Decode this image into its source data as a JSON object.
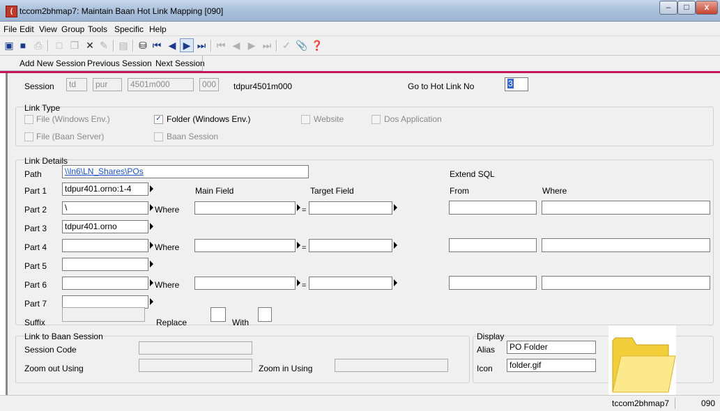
{
  "window": {
    "title": "tccom2bhmap7: Maintain Baan Hot Link Mapping [090]",
    "app_icon": "baan-app-icon",
    "minimize": "–",
    "maximize": "□",
    "close": "x"
  },
  "menu": [
    "File",
    "Edit",
    "View",
    "Group",
    "Tools",
    "Specific",
    "Help"
  ],
  "toolbar": {
    "buttons": [
      "save-and-close-icon",
      "save-icon",
      "print-icon",
      "new-icon",
      "duplicate-icon",
      "delete-icon",
      "change-icon",
      "text-icon",
      "find-icon",
      "first-record-icon",
      "previous-record-icon",
      "next-record-icon",
      "last-record-icon",
      "first-set-icon",
      "previous-set-icon",
      "next-set-icon",
      "last-set-icon",
      "special-icon",
      "attachment-icon",
      "whats-this-icon"
    ]
  },
  "session_bar": {
    "add_new_session": "Add New Session",
    "previous_session": "Previous Session",
    "next_session": "Next Session"
  },
  "header": {
    "session_label": "Session",
    "package": "td",
    "module": "pur",
    "session_code": "4501m000",
    "vrc": "000",
    "session_name": "tdpur4501m000",
    "go_to_label": "Go to Hot Link No",
    "go_to_value": "3"
  },
  "link_type": {
    "title": "Link Type",
    "file_windows": "File (Windows Env.)",
    "folder_windows": "Folder (Windows Env.)",
    "website": "Website",
    "dos_application": "Dos Application",
    "file_baan_server": "File (Baan Server)",
    "baan_session": "Baan Session",
    "checked": "folder_windows"
  },
  "link_details": {
    "title": "Link Details",
    "path_label": "Path",
    "path_value": "\\\\ln6\\LN_Shares\\POs",
    "extend_sql": "Extend SQL",
    "main_field": "Main Field",
    "target_field": "Target Field",
    "from": "From",
    "where_col": "Where",
    "where": "Where",
    "equals": "=",
    "parts": [
      {
        "label": "Part 1",
        "value": "tdpur401.orno:1-4"
      },
      {
        "label": "Part 2",
        "value": "\\"
      },
      {
        "label": "Part 3",
        "value": "tdpur401.orno"
      },
      {
        "label": "Part 4",
        "value": ""
      },
      {
        "label": "Part 5",
        "value": ""
      },
      {
        "label": "Part 6",
        "value": ""
      },
      {
        "label": "Part 7",
        "value": ""
      }
    ],
    "suffix_label": "Suffix",
    "replace_label": "Replace",
    "with_label": "With"
  },
  "link_to_baan": {
    "title": "Link to Baan Session",
    "session_code": "Session Code",
    "zoom_out": "Zoom out Using",
    "zoom_in": "Zoom in Using"
  },
  "display": {
    "title": "Display",
    "alias_label": "Alias",
    "alias_value": "PO Folder",
    "icon_label": "Icon",
    "icon_value": "folder.gif",
    "preview": "folder-icon"
  },
  "status": {
    "session": "tccom2bhmap7",
    "company": "090"
  }
}
